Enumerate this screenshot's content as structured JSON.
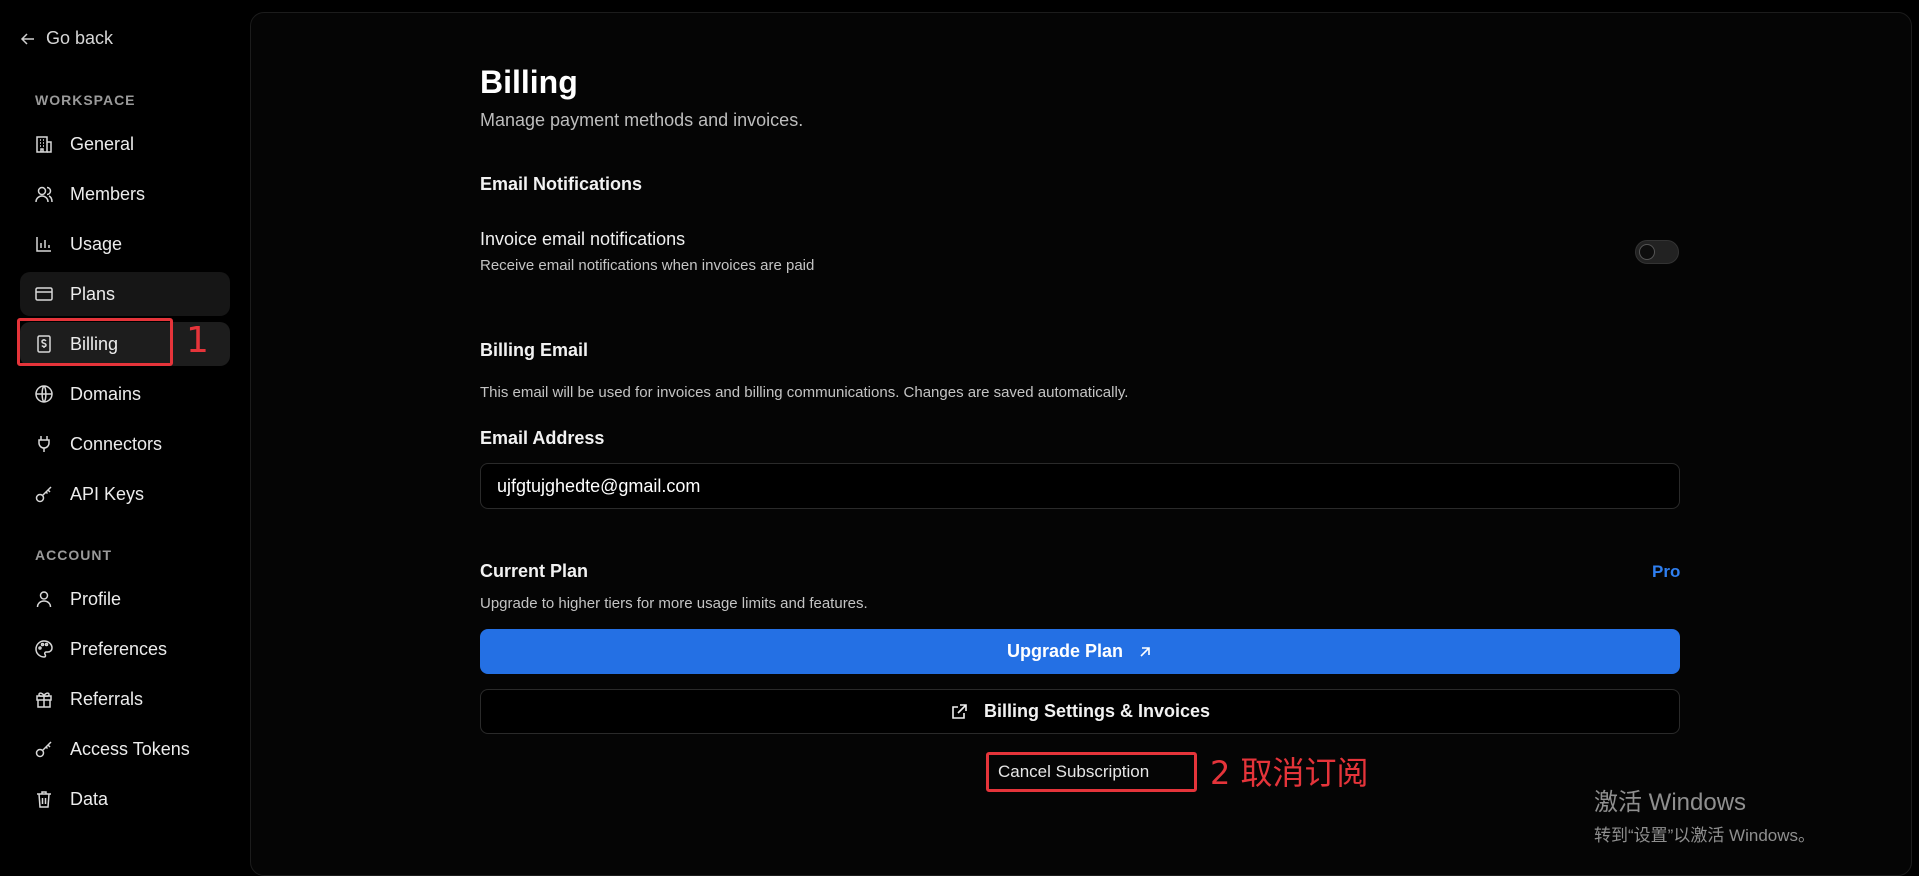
{
  "sidebar": {
    "go_back": "Go back",
    "workspace_label": "WORKSPACE",
    "account_label": "ACCOUNT",
    "workspace_items": [
      {
        "label": "General",
        "icon": "building-icon"
      },
      {
        "label": "Members",
        "icon": "users-icon"
      },
      {
        "label": "Usage",
        "icon": "bar-chart-icon"
      },
      {
        "label": "Plans",
        "icon": "credit-card-icon"
      },
      {
        "label": "Billing",
        "icon": "dollar-receipt-icon"
      },
      {
        "label": "Domains",
        "icon": "globe-icon"
      },
      {
        "label": "Connectors",
        "icon": "plug-icon"
      },
      {
        "label": "API Keys",
        "icon": "key-icon"
      }
    ],
    "account_items": [
      {
        "label": "Profile",
        "icon": "user-icon"
      },
      {
        "label": "Preferences",
        "icon": "palette-icon"
      },
      {
        "label": "Referrals",
        "icon": "gift-icon"
      },
      {
        "label": "Access Tokens",
        "icon": "key-icon"
      },
      {
        "label": "Data",
        "icon": "trash-icon"
      }
    ]
  },
  "annotations": {
    "step1": "1",
    "step2": "2 取消订阅",
    "color": "#e5343a"
  },
  "billing": {
    "title": "Billing",
    "subtitle": "Manage payment methods and invoices.",
    "email_notifications_heading": "Email Notifications",
    "invoice_notifications_label": "Invoice email notifications",
    "invoice_notifications_desc": "Receive email notifications when invoices are paid",
    "invoice_notifications_enabled": false,
    "billing_email_heading": "Billing Email",
    "billing_email_desc": "This email will be used for invoices and billing communications. Changes are saved automatically.",
    "email_address_label": "Email Address",
    "email_value": "ujfgtujghedte@gmail.com",
    "current_plan_heading": "Current Plan",
    "current_plan_value": "Pro",
    "current_plan_desc": "Upgrade to higher tiers for more usage limits and features.",
    "upgrade_button": "Upgrade Plan",
    "billing_settings_button": "Billing Settings & Invoices",
    "cancel_button": "Cancel Subscription"
  },
  "watermark": {
    "line1": "激活 Windows",
    "line2": "转到“设置”以激活 Windows。"
  },
  "colors": {
    "accent": "#2470e4",
    "pro": "#2f7ff0",
    "background": "#000000"
  }
}
